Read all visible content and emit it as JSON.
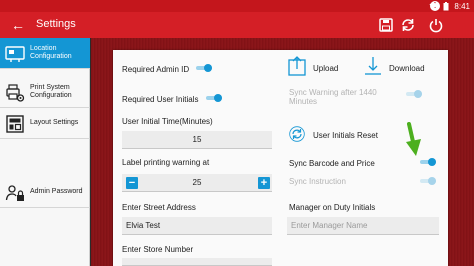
{
  "status_bar": {
    "time": "8:41"
  },
  "app_bar": {
    "title": "Settings"
  },
  "sidebar": {
    "items": [
      {
        "label_line1": "Location",
        "label_line2": "Configuration",
        "active": true
      },
      {
        "label_line1": "Print System",
        "label_line2": "Configuration",
        "active": false
      },
      {
        "label_line1": "Layout Settings",
        "label_line2": "",
        "active": false
      },
      {
        "label_line1": "Admin Password",
        "label_line2": "",
        "active": false
      }
    ]
  },
  "settings": {
    "required_admin_id": {
      "label": "Required Admin ID",
      "on": true
    },
    "required_user_initials": {
      "label": "Required User Initials",
      "on": true
    },
    "user_initial_time": {
      "label": "User Initial Time(Minutes)",
      "value": "15"
    },
    "label_printing_warning": {
      "label": "Label printing warning at",
      "value": "25",
      "minus": "−",
      "plus": "+"
    },
    "street_address": {
      "label": "Enter Street Address",
      "value": "Elvia Test"
    },
    "store_number": {
      "label": "Enter Store Number"
    },
    "upload": {
      "label": "Upload"
    },
    "download": {
      "label": "Download"
    },
    "sync_warning": {
      "label": "Sync Warning after 1440 Minutes",
      "on": true,
      "enabled": false
    },
    "user_initials_reset": {
      "label": "User Initials Reset"
    },
    "sync_barcode_price": {
      "label": "Sync Barcode and Price",
      "on": true
    },
    "sync_instruction": {
      "label": "Sync Instruction",
      "on": true,
      "enabled": false
    },
    "manager_on_duty": {
      "label": "Manager on Duty Initials",
      "placeholder": "Enter Manager Name"
    }
  },
  "colors": {
    "primary_red": "#d41f26",
    "status_red": "#c4161c",
    "accent_blue": "#1496d4",
    "annotation_green": "#4caf1e"
  }
}
